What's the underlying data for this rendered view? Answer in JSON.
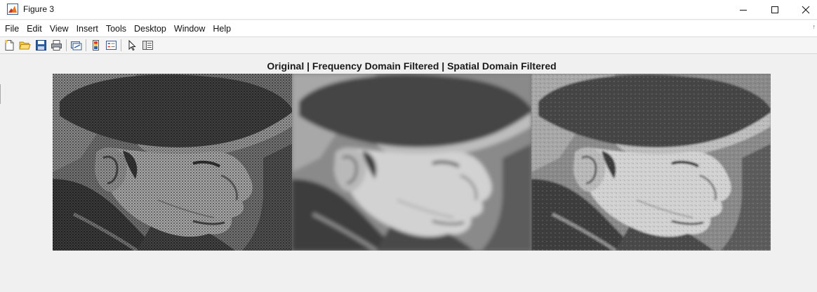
{
  "window": {
    "title": "Figure 3"
  },
  "menu": {
    "items": [
      "File",
      "Edit",
      "View",
      "Insert",
      "Tools",
      "Desktop",
      "Window",
      "Help"
    ]
  },
  "toolbar": {
    "buttons": [
      {
        "name": "new-figure-icon"
      },
      {
        "name": "open-file-icon"
      },
      {
        "name": "save-icon"
      },
      {
        "name": "print-icon"
      },
      {
        "name": "link-plot-icon"
      },
      {
        "name": "insert-colorbar-icon"
      },
      {
        "name": "insert-legend-icon"
      },
      {
        "name": "edit-plot-pointer-icon"
      },
      {
        "name": "property-inspector-icon"
      }
    ]
  },
  "figure": {
    "title": "Original | Frequency Domain Filtered | Spatial Domain Filtered",
    "panels": [
      "original",
      "frequency-domain-filtered",
      "spatial-domain-filtered"
    ]
  }
}
